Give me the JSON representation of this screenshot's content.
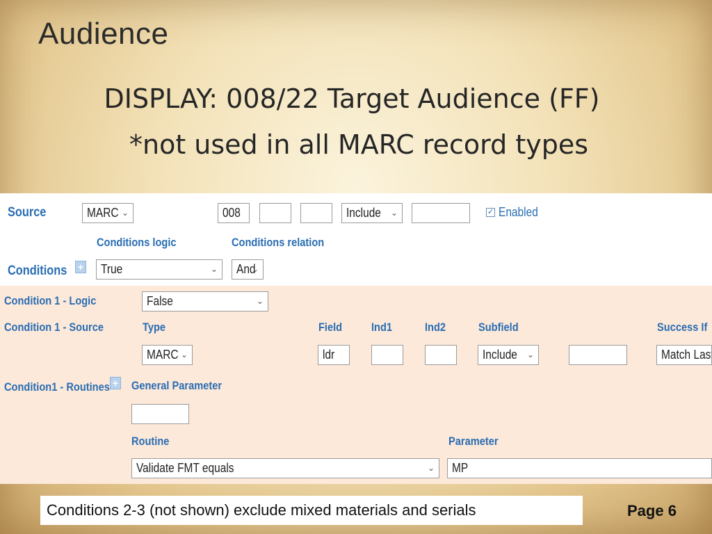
{
  "slide": {
    "title": "Audience",
    "subtitle_line1": "DISPLAY: 008/22 Target Audience (FF)",
    "subtitle_line2": "*not used in all MARC record types",
    "footer_note": "Conditions 2-3 (not shown) exclude mixed materials and serials",
    "page": "Page 6"
  },
  "form": {
    "source": {
      "label": "Source",
      "type_value": "MARC",
      "field_value": "008",
      "ind1_value": "",
      "ind2_value": "",
      "subfield_mode": "Include",
      "subfield_value": "",
      "enabled_label": "Enabled",
      "enabled_checked": true
    },
    "conditions": {
      "label": "Conditions",
      "logic_label": "Conditions logic",
      "logic_value": "True",
      "relation_label": "Conditions relation",
      "relation_value": "And"
    },
    "condition1": {
      "logic_label": "Condition 1 - Logic",
      "logic_value": "False",
      "source_label": "Condition 1 - Source",
      "type_label": "Type",
      "type_value": "MARC",
      "field_label": "Field",
      "field_value": "ldr",
      "ind1_label": "Ind1",
      "ind1_value": "",
      "ind2_label": "Ind2",
      "ind2_value": "",
      "subfield_label": "Subfield",
      "subfield_mode": "Include",
      "subfield_value": "",
      "success_label": "Success If",
      "success_value": "Match Last",
      "routines_label": "Condition1 - Routines",
      "general_param_label": "General Parameter",
      "general_param_value": "",
      "routine_label": "Routine",
      "routine_value": "Validate FMT equals",
      "parameter_label": "Parameter",
      "parameter_value": "MP"
    }
  },
  "colors": {
    "label_blue": "#2a6db2",
    "peach_bg": "#fde9da"
  }
}
